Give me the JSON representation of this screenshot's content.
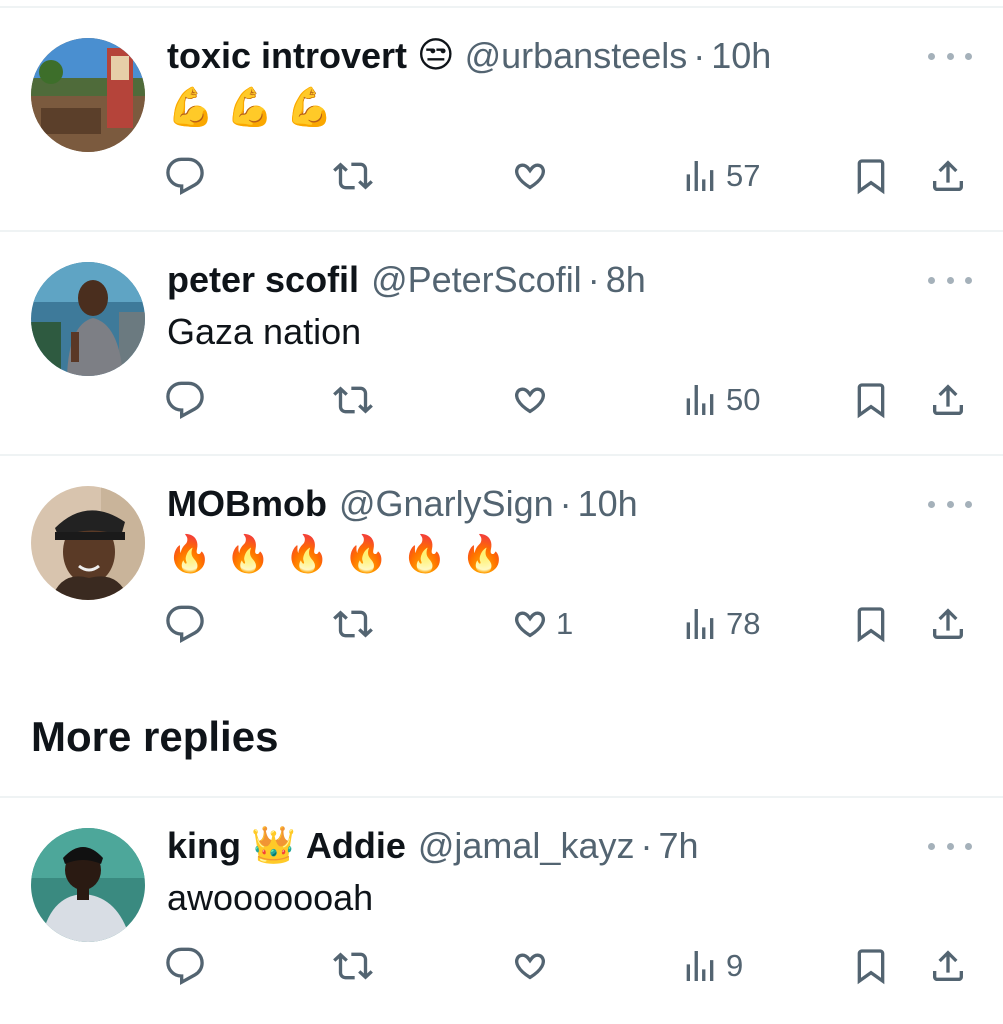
{
  "replies": [
    {
      "name": "toxic introvert",
      "name_emoji": "😒",
      "handle": "@urbansteels",
      "time": "10h",
      "text": "",
      "emoji_row": [
        "💪",
        "💪",
        "💪"
      ],
      "likes": "",
      "views": "57",
      "avatar_icon": "avatar-toxic-introvert"
    },
    {
      "name": "peter scofil",
      "handle": "@PeterScofil",
      "time": "8h",
      "text": "Gaza nation",
      "likes": "",
      "views": "50",
      "avatar_icon": "avatar-peter-scofil"
    },
    {
      "name": "MOBmob",
      "handle": "@GnarlySign",
      "time": "10h",
      "text": "",
      "emoji_row": [
        "🔥",
        "🔥",
        "🔥",
        "🔥",
        "🔥",
        "🔥"
      ],
      "likes": "1",
      "views": "78",
      "avatar_icon": "avatar-mobmob"
    },
    {
      "name_part1": "king",
      "name_emoji": "👑",
      "name_part2": "Addie",
      "handle": "@jamal_kayz",
      "time": "7h",
      "text": "awooooooah",
      "likes": "",
      "views": "9",
      "avatar_icon": "avatar-king-addie"
    }
  ],
  "section": {
    "more_replies": "More replies"
  },
  "separator": "·",
  "colors": {
    "text": "#0f1419",
    "secondary": "#536471",
    "divider": "#eff3f4",
    "icon": "#536471"
  }
}
